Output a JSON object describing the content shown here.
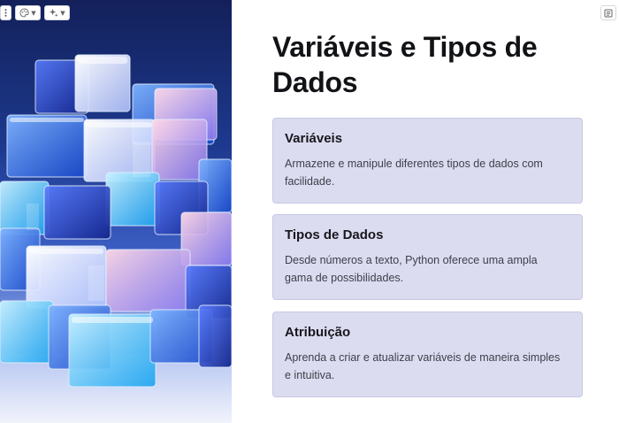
{
  "toolbar": {
    "menu_icon": "vertical-dots-icon",
    "theme_icon": "palette-icon",
    "ai_icon": "sparkle-icon",
    "notes_icon": "notes-icon"
  },
  "slide": {
    "title": "Variáveis e Tipos de Dados",
    "cards": [
      {
        "title": "Variáveis",
        "text": "Armazene e manipule diferentes tipos de dados com facilidade."
      },
      {
        "title": "Tipos de Dados",
        "text": "Desde números a texto, Python oferece uma ampla gama de possibilidades."
      },
      {
        "title": "Atribuição",
        "text": "Aprenda a criar e atualizar variáveis de maneira simples e intuitiva."
      }
    ]
  },
  "colors": {
    "card_background": "#dcdcf1",
    "card_border": "#c8c8e3",
    "title_text": "#121316",
    "body_text": "#3d3f48"
  },
  "image": {
    "subject": "glass-cubes-illustration"
  }
}
